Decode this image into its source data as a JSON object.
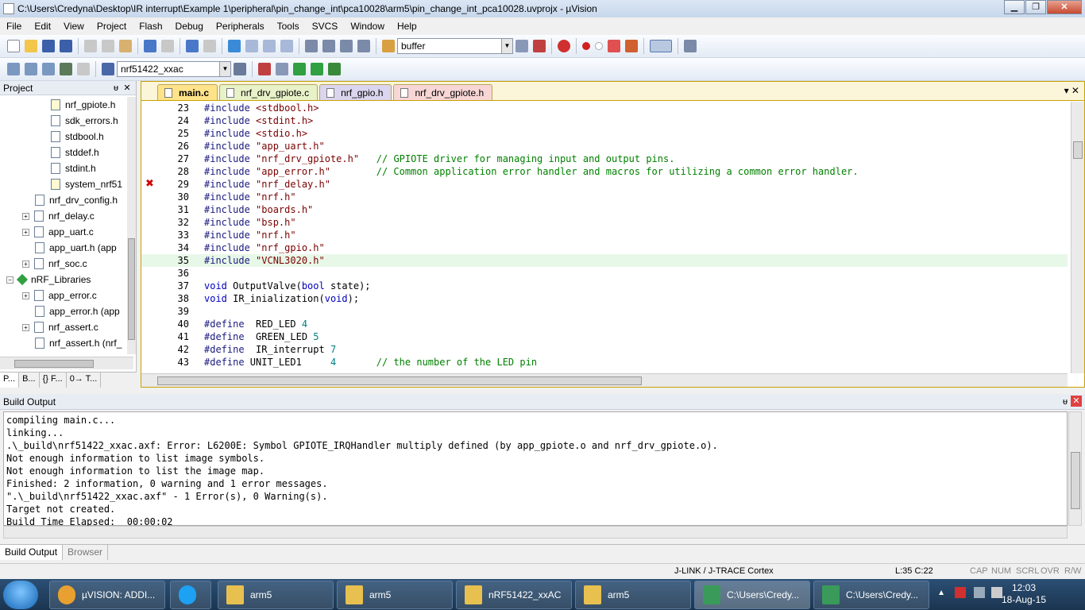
{
  "window": {
    "title": "C:\\Users\\Credyna\\Desktop\\IR interrupt\\Example 1\\peripheral\\pin_change_int\\pca10028\\arm5\\pin_change_int_pca10028.uvprojx - µVision",
    "min": "▁",
    "max": "❐",
    "close": "✕"
  },
  "menu": [
    "File",
    "Edit",
    "View",
    "Project",
    "Flash",
    "Debug",
    "Peripherals",
    "Tools",
    "SVCS",
    "Window",
    "Help"
  ],
  "toolbar": {
    "find_value": "buffer",
    "target_value": "nrf51422_xxac"
  },
  "project_panel": {
    "title": "Project",
    "pin": "ᵾ",
    "close": "✕",
    "items": [
      {
        "label": "nrf_gpiote.h",
        "indent": 3
      },
      {
        "label": "sdk_errors.h",
        "indent": 3
      },
      {
        "label": "stdbool.h",
        "indent": 3
      },
      {
        "label": "stddef.h",
        "indent": 3
      },
      {
        "label": "stdint.h",
        "indent": 3
      },
      {
        "label": "system_nrf51",
        "indent": 3
      },
      {
        "label": "nrf_drv_config.h",
        "indent": 2
      },
      {
        "label": "nrf_delay.c",
        "indent": 1
      },
      {
        "label": "app_uart.c",
        "indent": 1
      },
      {
        "label": "app_uart.h (app",
        "indent": 2
      },
      {
        "label": "nrf_soc.c",
        "indent": 1
      },
      {
        "label": "nRF_Libraries",
        "indent": 0
      },
      {
        "label": "app_error.c",
        "indent": 1
      },
      {
        "label": "app_error.h (app",
        "indent": 2
      },
      {
        "label": "nrf_assert.c",
        "indent": 1
      },
      {
        "label": "nrf_assert.h (nrf_",
        "indent": 2
      }
    ],
    "tabs": [
      "P...",
      "B...",
      "{} F...",
      "0→ T..."
    ]
  },
  "editor": {
    "tabs": [
      "main.c",
      "nrf_drv_gpiote.c",
      "nrf_gpio.h",
      "nrf_drv_gpiote.h"
    ],
    "tabs_ctrl": "▾   ✕",
    "lines": [
      {
        "n": "23",
        "pp": "#include",
        "arg": "<stdbool.h>",
        "cmt": ""
      },
      {
        "n": "24",
        "pp": "#include",
        "arg": "<stdint.h>",
        "cmt": ""
      },
      {
        "n": "25",
        "pp": "#include",
        "arg": "<stdio.h>",
        "cmt": ""
      },
      {
        "n": "26",
        "pp": "#include",
        "arg": "\"app_uart.h\"",
        "cmt": ""
      },
      {
        "n": "27",
        "pp": "#include",
        "arg": "\"nrf_drv_gpiote.h\"",
        "cmt": "// GPIOTE driver for managing input and output pins."
      },
      {
        "n": "28",
        "pp": "#include",
        "arg": "\"app_error.h\"",
        "cmt": "// Common application error handler and macros for utilizing a common error handler."
      },
      {
        "n": "29",
        "pp": "#include",
        "arg": "\"nrf_delay.h\"",
        "cmt": ""
      },
      {
        "n": "30",
        "pp": "#include",
        "arg": "\"nrf.h\"",
        "cmt": ""
      },
      {
        "n": "31",
        "pp": "#include",
        "arg": "\"boards.h\"",
        "cmt": ""
      },
      {
        "n": "32",
        "pp": "#include",
        "arg": "\"bsp.h\"",
        "cmt": ""
      },
      {
        "n": "33",
        "pp": "#include",
        "arg": "\"nrf.h\"",
        "cmt": ""
      },
      {
        "n": "34",
        "pp": "#include",
        "arg": "\"nrf_gpio.h\"",
        "cmt": ""
      },
      {
        "n": "35",
        "pp": "#include",
        "arg": "\"VCNL3020.h\"",
        "cmt": ""
      },
      {
        "n": "36",
        "pp": "",
        "arg": "",
        "cmt": ""
      },
      {
        "n": "37",
        "pp": "",
        "arg": "",
        "cmt": "",
        "raw": [
          "void",
          " OutputValve(",
          "bool",
          " state);"
        ]
      },
      {
        "n": "38",
        "pp": "",
        "arg": "",
        "cmt": "",
        "raw": [
          "void",
          " IR_inialization(",
          "void",
          ");"
        ]
      },
      {
        "n": "39",
        "pp": "",
        "arg": "",
        "cmt": ""
      },
      {
        "n": "40",
        "pp": "#define",
        "arg": "  RED_LED ",
        "val": "4",
        "cmt": ""
      },
      {
        "n": "41",
        "pp": "#define",
        "arg": "  GREEN_LED ",
        "val": "5",
        "cmt": ""
      },
      {
        "n": "42",
        "pp": "#define",
        "arg": "  IR_interrupt ",
        "val": "7",
        "cmt": ""
      },
      {
        "n": "43",
        "pp": "#define",
        "arg": " UNIT_LED1     ",
        "val": "4",
        "cmt": "// the number of the LED pin"
      }
    ],
    "error_marker": "✖"
  },
  "build_output": {
    "title": "Build Output",
    "pin": "ᵾ",
    "close": "✕",
    "lines": [
      "compiling main.c...",
      "linking...",
      ".\\_build\\nrf51422_xxac.axf: Error: L6200E: Symbol GPIOTE_IRQHandler multiply defined (by app_gpiote.o and nrf_drv_gpiote.o).",
      "Not enough information to list image symbols.",
      "Not enough information to list the image map.",
      "Finished: 2 information, 0 warning and 1 error messages.",
      "\".\\_build\\nrf51422_xxac.axf\" - 1 Error(s), 0 Warning(s).",
      "Target not created.",
      "Build Time Elapsed:  00:00:02"
    ],
    "tabs": [
      "Build Output",
      "Browser"
    ]
  },
  "status": {
    "debugger": "J-LINK / J-TRACE Cortex",
    "position": "L:35 C:22",
    "caps": "CAP",
    "num": "NUM",
    "scrl": "SCRL",
    "ovr": "OVR",
    "rw": "R/W"
  },
  "taskbar": {
    "items": [
      {
        "label": "µVISION: ADDI...",
        "color": "#e8a030"
      },
      {
        "label": "",
        "color": "#1da1f2"
      },
      {
        "label": "arm5",
        "color": "#e8c050"
      },
      {
        "label": "arm5",
        "color": "#e8c050"
      },
      {
        "label": "nRF51422_xxAC",
        "color": "#e8c050"
      },
      {
        "label": "arm5",
        "color": "#e8c050"
      },
      {
        "label": "C:\\Users\\Credy...",
        "color": "#3a9a5a"
      },
      {
        "label": "C:\\Users\\Credy...",
        "color": "#3a9a5a"
      }
    ],
    "time": "12:03",
    "date": "18-Aug-15"
  }
}
